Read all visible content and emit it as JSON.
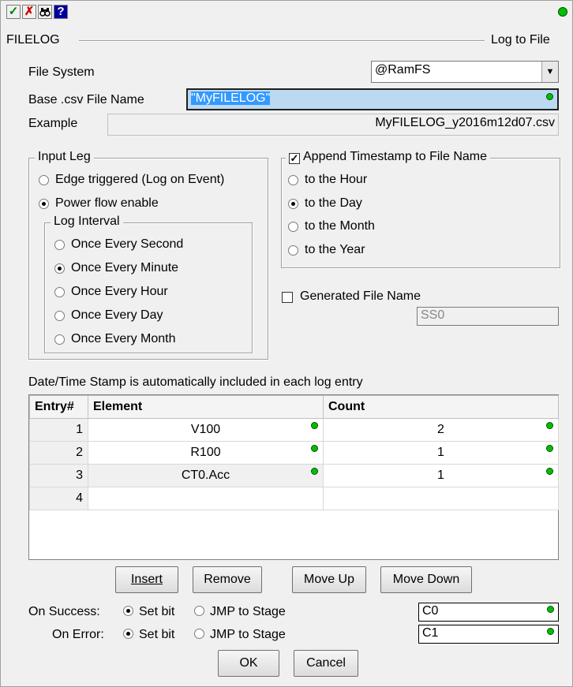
{
  "toolbar": {
    "accept_icon": "check-icon",
    "cancel_icon": "x-icon",
    "search_icon": "binoculars-icon",
    "help_label": "?"
  },
  "header": {
    "left": "FILELOG",
    "right": "Log to File"
  },
  "file_system": {
    "label": "File System",
    "value": "@RamFS"
  },
  "base_name": {
    "label": "Base .csv File Name",
    "value": "\"MyFILELOG\""
  },
  "example": {
    "label": "Example",
    "value": "MyFILELOG_y2016m12d07.csv"
  },
  "input_leg": {
    "title": "Input Leg",
    "options": [
      "Edge triggered (Log on Event)",
      "Power flow enable"
    ],
    "selected": 1,
    "log_interval": {
      "title": "Log Interval",
      "options": [
        "Once Every Second",
        "Once Every Minute",
        "Once Every Hour",
        "Once Every Day",
        "Once Every Month"
      ],
      "selected": 1
    }
  },
  "timestamp": {
    "title": "Append Timestamp to File Name",
    "checked": true,
    "options": [
      "to the Hour",
      "to the Day",
      "to the Month",
      "to the Year"
    ],
    "selected": 1
  },
  "generated": {
    "label": "Generated File Name",
    "checked": false,
    "value": "SS0"
  },
  "note": "Date/Time Stamp is automatically included in each log entry",
  "table": {
    "headers": [
      "Entry#",
      "Element",
      "Count"
    ],
    "rows": [
      {
        "entry": "1",
        "element": "V100",
        "count": "2"
      },
      {
        "entry": "2",
        "element": "R100",
        "count": "1"
      },
      {
        "entry": "3",
        "element": "CT0.Acc",
        "count": "1"
      },
      {
        "entry": "4",
        "element": "",
        "count": ""
      }
    ]
  },
  "buttons": {
    "insert": "Insert",
    "remove": "Remove",
    "move_up": "Move Up",
    "move_down": "Move Down",
    "ok": "OK",
    "cancel": "Cancel"
  },
  "on_success": {
    "label": "On Success:",
    "opt1": "Set bit",
    "opt2": "JMP to Stage",
    "value": "C0"
  },
  "on_error": {
    "label": "On Error:",
    "opt1": "Set bit",
    "opt2": "JMP to Stage",
    "value": "C1"
  },
  "colors": {
    "status_led": "#00c000",
    "selection": "#3399ff"
  }
}
